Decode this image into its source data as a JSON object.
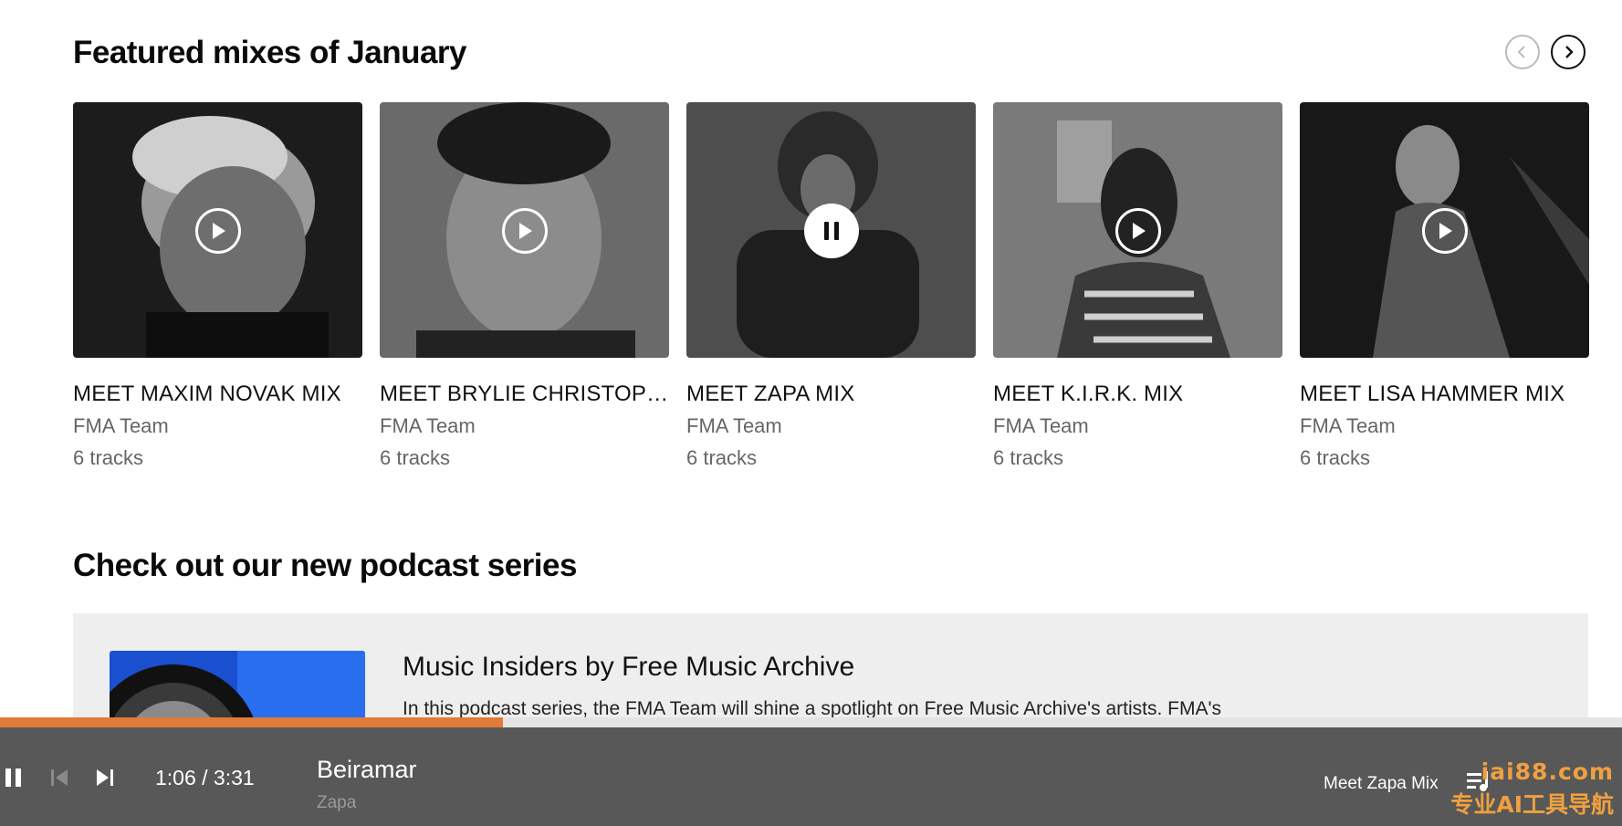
{
  "featured": {
    "title": "Featured mixes of January",
    "nav_prev_icon": "chevron-left-icon",
    "nav_next_icon": "chevron-right-icon",
    "cards": [
      {
        "title": "MEET MAXIM NOVAK MIX",
        "curator": "FMA Team",
        "tracks": "6 tracks",
        "state": "play"
      },
      {
        "title": "MEET BRYLIE CHRISTOPHER MIX",
        "curator": "FMA Team",
        "tracks": "6 tracks",
        "state": "play"
      },
      {
        "title": "MEET ZAPA MIX",
        "curator": "FMA Team",
        "tracks": "6 tracks",
        "state": "pause"
      },
      {
        "title": "MEET K.I.R.K. MIX",
        "curator": "FMA Team",
        "tracks": "6 tracks",
        "state": "play"
      },
      {
        "title": "MEET LISA HAMMER MIX",
        "curator": "FMA Team",
        "tracks": "6 tracks",
        "state": "play"
      }
    ]
  },
  "podcast": {
    "section_title": "Check out our new podcast series",
    "heading": "Music Insiders by Free Music Archive",
    "description": "In this podcast series, the FMA Team will shine a spotlight on Free Music Archive's artists. FMA's"
  },
  "player": {
    "progress_fraction": 0.31,
    "time": "1:06 / 3:31",
    "track_title": "Beiramar",
    "track_artist": "Zapa",
    "mix_name": "Meet Zapa Mix",
    "accent_color": "#e07b39",
    "bar_color": "#585858"
  },
  "watermark": {
    "line1": "iai88.com",
    "line2": "专业AI工具导航"
  }
}
